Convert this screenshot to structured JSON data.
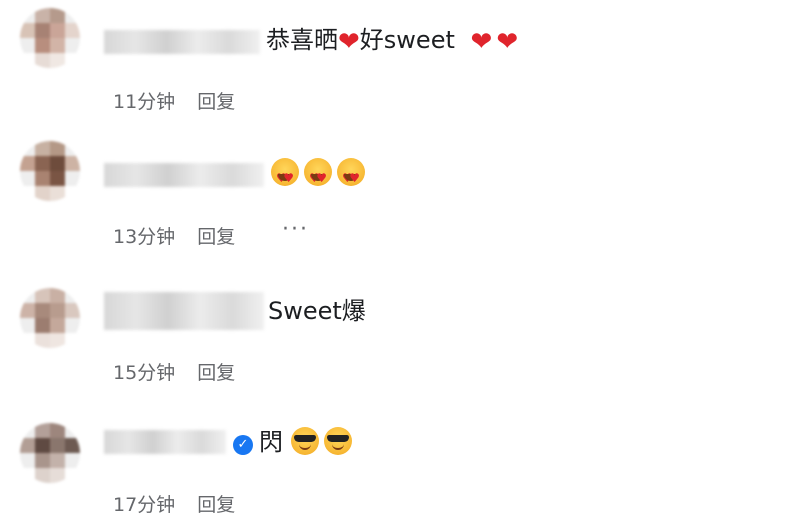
{
  "comments": [
    {
      "text": "恭喜晒",
      "text2": "好sweet",
      "time": "11分钟",
      "reply": "回复"
    },
    {
      "time": "13分钟",
      "reply": "回复",
      "more": "···"
    },
    {
      "text": "Sweet爆",
      "time": "15分钟",
      "reply": "回复"
    },
    {
      "text": "閃",
      "time": "17分钟",
      "reply": "回复"
    }
  ],
  "icons": {
    "heart": "red-heart-icon",
    "heart_eyes": "heart-eyes-emoji-icon",
    "sunglasses": "sunglasses-emoji-icon",
    "verified": "verified-badge-icon"
  },
  "colors": {
    "heart": "#e0242c",
    "meta_text": "#65676b",
    "verified": "#1877f2"
  }
}
